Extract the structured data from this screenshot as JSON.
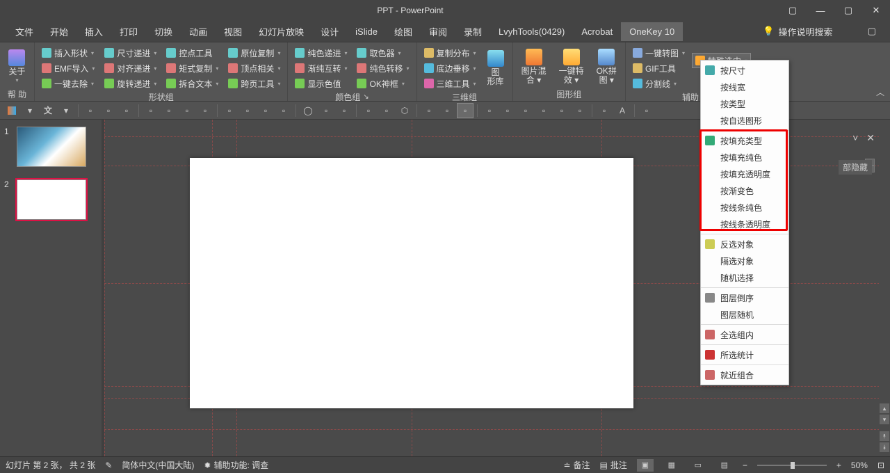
{
  "title": "PPT - PowerPoint",
  "tabs": [
    "文件",
    "开始",
    "插入",
    "打印",
    "切换",
    "动画",
    "视图",
    "幻灯片放映",
    "设计",
    "iSlide",
    "绘图",
    "审阅",
    "录制",
    "LvyhTools(0429)",
    "Acrobat",
    "OneKey 10"
  ],
  "active_tab": "OneKey 10",
  "search_label": "操作说明搜索",
  "ribbon": {
    "help": {
      "label": "帮 助",
      "button": "关于"
    },
    "shape": {
      "label": "形状组",
      "c1": [
        "插入形状",
        "EMF导入",
        "一键去除"
      ],
      "c2": [
        "尺寸递进",
        "对齐递进",
        "旋转递进"
      ],
      "c3": [
        "控点工具",
        "矩式复制",
        "拆合文本"
      ],
      "c4": [
        "原位复制",
        "顶点相关",
        "跨页工具"
      ]
    },
    "color": {
      "label": "颜色组",
      "c1": [
        "纯色递进",
        "渐纯互转",
        "显示色值"
      ],
      "c2": [
        "取色器",
        "纯色转移",
        "OK神框"
      ]
    },
    "threeD": {
      "label": "三维组",
      "c1": [
        "复制分布",
        "底边垂移",
        "三维工具"
      ],
      "big": "图\n形库"
    },
    "graphics": {
      "label": "图形组",
      "b1": "图片混\n合 ▾",
      "b2": "一键特\n效 ▾",
      "b3": "OK拼\n图 ▾"
    },
    "aux": {
      "label": "辅助",
      "c1": [
        "一键转图",
        "GIF工具",
        "分割线"
      ],
      "special": "特殊选中"
    }
  },
  "menu": {
    "items": [
      {
        "label": "按尺寸",
        "ic": "#4aa"
      },
      {
        "label": "按线宽"
      },
      {
        "label": "按类型"
      },
      {
        "label": "按自选图形"
      },
      {
        "label": "按填充类型",
        "ic": "#3a7",
        "hl_start": true
      },
      {
        "label": "按填充纯色"
      },
      {
        "label": "按填充透明度"
      },
      {
        "label": "按渐变色"
      },
      {
        "label": "按线条纯色"
      },
      {
        "label": "按线条透明度",
        "hl_end": true
      },
      {
        "label": "反选对象",
        "ic": "#cc5"
      },
      {
        "label": "隔选对象"
      },
      {
        "label": "随机选择"
      },
      {
        "label": "图层倒序",
        "ic": "#888"
      },
      {
        "label": "图层随机"
      },
      {
        "label": "全选组内",
        "ic": "#c66"
      },
      {
        "label": "所选统计",
        "ic": "#c33"
      },
      {
        "label": "就近组合",
        "ic": "#c66"
      }
    ]
  },
  "rpanel_peek": "部隐藏",
  "status": {
    "slide": "幻灯片 第 2 张， 共 2 张",
    "lang_icon": "",
    "lang": "简体中文(中国大陆)",
    "access": "辅助功能: 调查",
    "notes": "备注",
    "comments": "批注",
    "zoom": "50%"
  }
}
